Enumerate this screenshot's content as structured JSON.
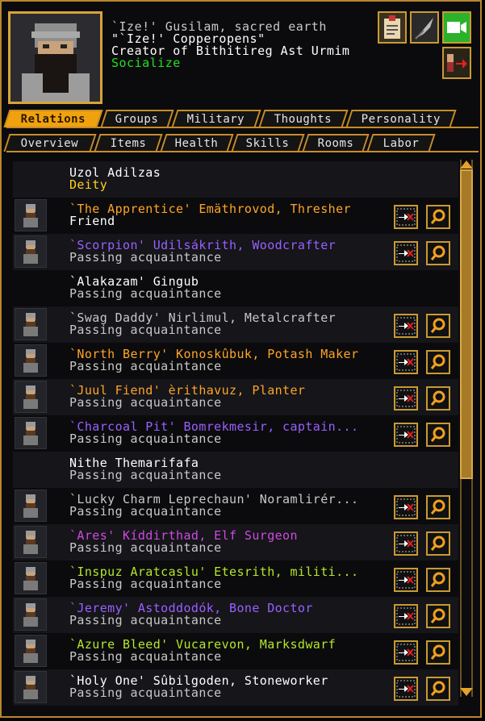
{
  "header": {
    "line1": "`Ize!' Gusilam, sacred earth",
    "line2": "\"`Ize!' Copperopens\"",
    "line3": "Creator of Bithitireg Ast Urmim",
    "line4": "Socialize"
  },
  "header_buttons": [
    {
      "name": "job-details-icon"
    },
    {
      "name": "feather-icon"
    },
    {
      "name": "camera-icon"
    },
    {
      "name": "exit-arrow-icon"
    }
  ],
  "tabs_main": [
    "Relations",
    "Groups",
    "Military",
    "Thoughts",
    "Personality"
  ],
  "tabs_sub": [
    "Overview",
    "Items",
    "Health",
    "Skills",
    "Rooms",
    "Labor"
  ],
  "colors": {
    "orange": "#ffa526",
    "white": "#ffffff",
    "grey": "#c8c8c8",
    "purple": "#9a60ff",
    "magenta": "#d04adf",
    "lime": "#b4e82a",
    "yellow": "#ffd21e",
    "green": "#22e022",
    "border": "#c88c26"
  },
  "relations": [
    {
      "name": "Uzol Adilzas",
      "relation": "Deity",
      "name_color": "white",
      "rel_color": "yellow",
      "avatar": false,
      "buttons": false
    },
    {
      "name": "`The Apprentice' Emäthrovod, Thresher",
      "relation": "Friend",
      "name_color": "orange",
      "rel_color": "white",
      "avatar": true,
      "buttons": true
    },
    {
      "name": "`Scorpion' Udilsákrith, Woodcrafter",
      "relation": "Passing acquaintance",
      "name_color": "purple",
      "rel_color": "grey",
      "avatar": true,
      "buttons": true
    },
    {
      "name": "`Alakazam' Gingub",
      "relation": "Passing acquaintance",
      "name_color": "white",
      "rel_color": "grey",
      "avatar": false,
      "buttons": false
    },
    {
      "name": "`Swag Daddy' Nirlimul, Metalcrafter",
      "relation": "Passing acquaintance",
      "name_color": "grey",
      "rel_color": "grey",
      "avatar": true,
      "buttons": true
    },
    {
      "name": "`North Berry' Konoskûbuk, Potash Maker",
      "relation": "Passing acquaintance",
      "name_color": "orange",
      "rel_color": "grey",
      "avatar": true,
      "buttons": true
    },
    {
      "name": "`Juul Fiend' èrithavuz, Planter",
      "relation": "Passing acquaintance",
      "name_color": "orange",
      "rel_color": "grey",
      "avatar": true,
      "buttons": true
    },
    {
      "name": "`Charcoal Pit' Bomrekmesir, captain...",
      "relation": "Passing acquaintance",
      "name_color": "purple",
      "rel_color": "grey",
      "avatar": true,
      "buttons": true
    },
    {
      "name": "Nithe Themarifafa",
      "relation": "Passing acquaintance",
      "name_color": "white",
      "rel_color": "grey",
      "avatar": false,
      "buttons": false
    },
    {
      "name": "`Lucky Charm Leprechaun' Noramlirér...",
      "relation": "Passing acquaintance",
      "name_color": "grey",
      "rel_color": "grey",
      "avatar": true,
      "buttons": true
    },
    {
      "name": "`Ares' Kíddirthad, Elf Surgeon",
      "relation": "Passing acquaintance",
      "name_color": "magenta",
      "rel_color": "grey",
      "avatar": true,
      "buttons": true
    },
    {
      "name": "`Inspuz Aratcaslu' Etesrith, militi...",
      "relation": "Passing acquaintance",
      "name_color": "lime",
      "rel_color": "grey",
      "avatar": true,
      "buttons": true
    },
    {
      "name": "`Jeremy' Astoddodók, Bone Doctor",
      "relation": "Passing acquaintance",
      "name_color": "purple",
      "rel_color": "grey",
      "avatar": true,
      "buttons": true
    },
    {
      "name": "`Azure Bleed' Vucarevon, Marksdwarf",
      "relation": "Passing acquaintance",
      "name_color": "lime",
      "rel_color": "grey",
      "avatar": true,
      "buttons": true
    },
    {
      "name": "`Holy One' Sûbilgoden, Stoneworker",
      "relation": "Passing acquaintance",
      "name_color": "white",
      "rel_color": "grey",
      "avatar": true,
      "buttons": true
    }
  ]
}
